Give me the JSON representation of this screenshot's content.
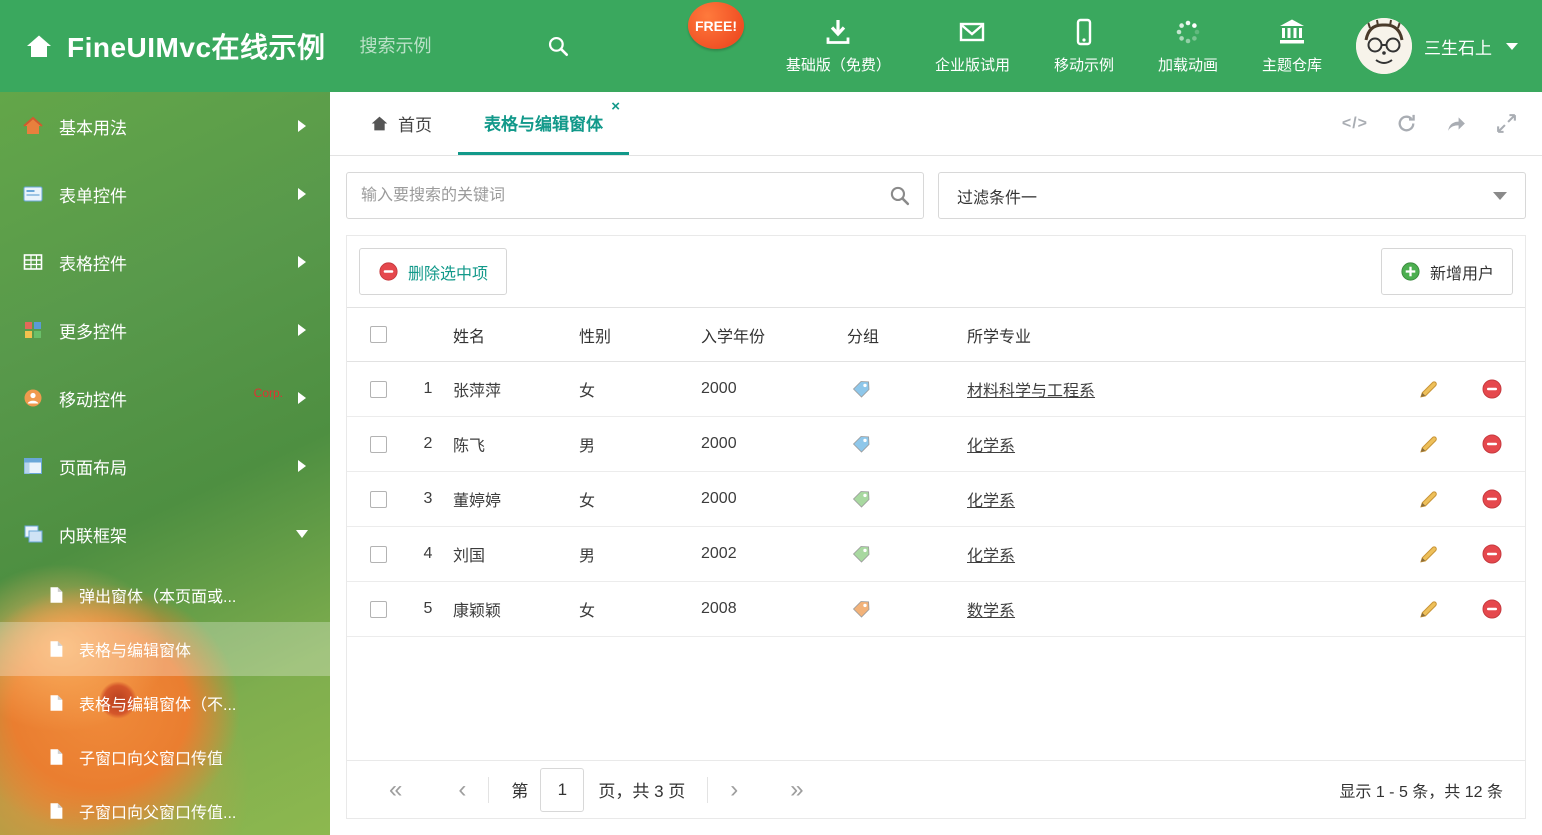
{
  "colors": {
    "header_green": "#3aa85e",
    "accent_teal": "#12998a",
    "free_badge": "#f04e23",
    "danger_red": "#e5484d",
    "success_green": "#4caf50",
    "pencil_orange": "#eec05a"
  },
  "header": {
    "title": "FineUIMvc在线示例",
    "search_placeholder": "搜索示例",
    "free_badge": "FREE!",
    "nav": [
      {
        "label": "基础版（免费）",
        "icon": "download-icon"
      },
      {
        "label": "企业版试用",
        "icon": "mail-icon"
      },
      {
        "label": "移动示例",
        "icon": "mobile-icon"
      },
      {
        "label": "加载动画",
        "icon": "spinner-icon"
      },
      {
        "label": "主题仓库",
        "icon": "bank-icon"
      }
    ],
    "user_name": "三生石上"
  },
  "sidebar": {
    "items": [
      {
        "label": "基本用法"
      },
      {
        "label": "表单控件"
      },
      {
        "label": "表格控件"
      },
      {
        "label": "更多控件"
      },
      {
        "label": "移动控件",
        "badge": "Corp."
      },
      {
        "label": "页面布局"
      },
      {
        "label": "内联框架"
      }
    ],
    "subitems": [
      {
        "label": "弹出窗体（本页面或..."
      },
      {
        "label": "表格与编辑窗体"
      },
      {
        "label": "表格与编辑窗体（不..."
      },
      {
        "label": "子窗口向父窗口传值"
      },
      {
        "label": "子窗口向父窗口传值..."
      }
    ]
  },
  "tabs": {
    "home": "首页",
    "active": "表格与编辑窗体",
    "close": "×"
  },
  "filter": {
    "search_placeholder": "输入要搜索的关键词",
    "dropdown_value": "过滤条件一"
  },
  "toolbar": {
    "delete_label": "删除选中项",
    "add_label": "新增用户"
  },
  "table": {
    "columns": {
      "name": "姓名",
      "gender": "性别",
      "year": "入学年份",
      "group": "分组",
      "major": "所学专业"
    },
    "rows": [
      {
        "index": "1",
        "name": "张萍萍",
        "gender": "女",
        "year": "2000",
        "tag_color": "#8ec7ea",
        "major": "材料科学与工程系"
      },
      {
        "index": "2",
        "name": "陈飞",
        "gender": "男",
        "year": "2000",
        "tag_color": "#8ec7ea",
        "major": "化学系"
      },
      {
        "index": "3",
        "name": "董婷婷",
        "gender": "女",
        "year": "2000",
        "tag_color": "#a8d8a0",
        "major": "化学系"
      },
      {
        "index": "4",
        "name": "刘国",
        "gender": "男",
        "year": "2002",
        "tag_color": "#a8d8a0",
        "major": "化学系"
      },
      {
        "index": "5",
        "name": "康颖颖",
        "gender": "女",
        "year": "2008",
        "tag_color": "#f2b279",
        "major": "数学系"
      }
    ]
  },
  "pagination": {
    "prefix": "第",
    "current_page": "1",
    "suffix": "页，共 3 页",
    "summary": "显示 1 - 5 条，共 12 条"
  }
}
